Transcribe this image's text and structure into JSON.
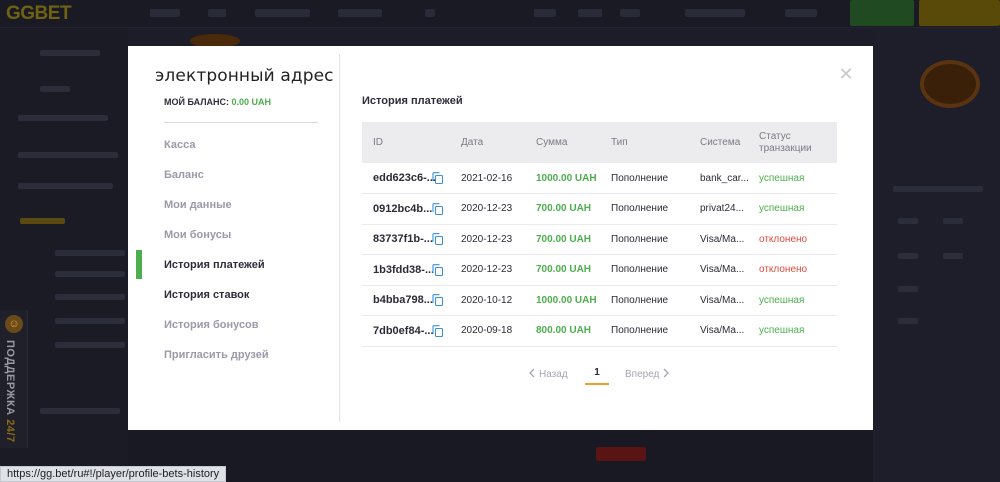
{
  "site": {
    "logo": "GGBET",
    "support_label": "ПОДДЕРЖКА",
    "support_suffix": "24/7",
    "status_url": "https://gg.bet/ru#!/player/profile-bets-history"
  },
  "profile": {
    "email": "электронный адрес",
    "balance_label": "МОЙ БАЛАНС:",
    "balance_value": "0.00 UAH"
  },
  "menu": {
    "items": [
      {
        "label": "Касса"
      },
      {
        "label": "Баланс"
      },
      {
        "label": "Мои данные"
      },
      {
        "label": "Мои бонусы"
      },
      {
        "label": "История платежей"
      },
      {
        "label": "История ставок"
      },
      {
        "label": "История бонусов"
      },
      {
        "label": "Пригласить друзей"
      }
    ]
  },
  "payments": {
    "title": "История платежей",
    "columns": [
      "ID",
      "Дата",
      "Сумма",
      "Тип",
      "Система",
      "Статус транзакции"
    ],
    "rows": [
      {
        "id": "edd623c6-...",
        "date": "2021-02-16",
        "amount": "1000.00 UAH",
        "type": "Пополнение",
        "system": "bank_car...",
        "status": "успешная"
      },
      {
        "id": "0912bc4b...",
        "date": "2020-12-23",
        "amount": "700.00 UAH",
        "type": "Пополнение",
        "system": "privat24...",
        "status": "успешная"
      },
      {
        "id": "83737f1b-...",
        "date": "2020-12-23",
        "amount": "700.00 UAH",
        "type": "Пополнение",
        "system": "Visa/Ma...",
        "status": "отклонено"
      },
      {
        "id": "1b3fdd38-...",
        "date": "2020-12-23",
        "amount": "700.00 UAH",
        "type": "Пополнение",
        "system": "Visa/Ma...",
        "status": "отклонено"
      },
      {
        "id": "b4bba798...",
        "date": "2020-10-12",
        "amount": "1000.00 UAH",
        "type": "Пополнение",
        "system": "Visa/Ma...",
        "status": "успешная"
      },
      {
        "id": "7db0ef84-...",
        "date": "2020-09-18",
        "amount": "800.00 UAH",
        "type": "Пополнение",
        "system": "Visa/Ma...",
        "status": "успешная"
      }
    ]
  },
  "pagination": {
    "prev": "Назад",
    "page": "1",
    "next": "Вперед"
  },
  "colors": {
    "accent_green": "#4cae4c",
    "error_red": "#e14a3a",
    "pager_underline": "#f0a020",
    "active_marker": "#4cae4c"
  },
  "icons": {
    "copy": "copy-icon",
    "close": "close-icon",
    "prev": "chevron-left-icon",
    "next": "chevron-right-icon",
    "support": "support-icon"
  }
}
